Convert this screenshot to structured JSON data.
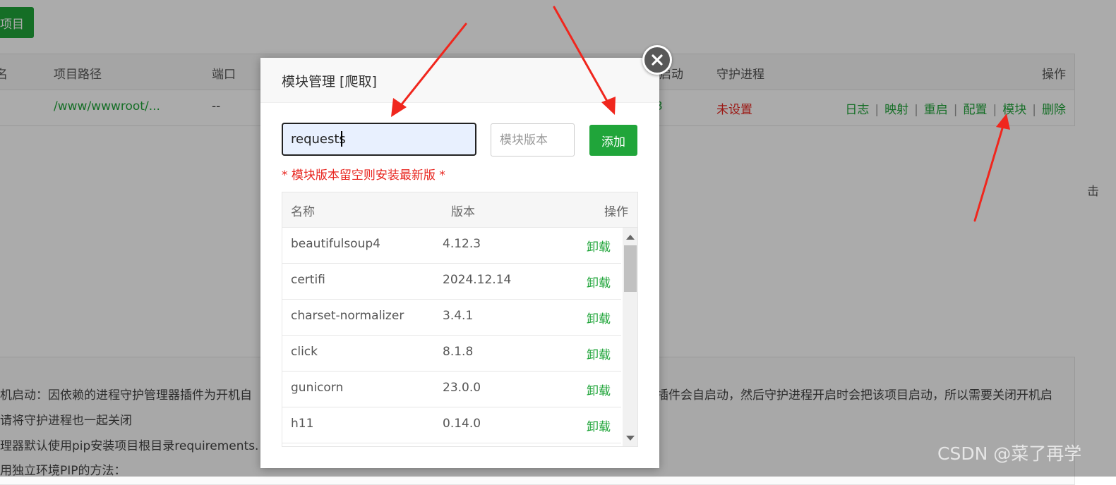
{
  "background": {
    "new_project_button": "项目",
    "table_headers": [
      "名",
      "项目路径",
      "端口",
      "启动",
      "守护进程",
      "操作"
    ],
    "row": {
      "path": "/www/wwwroot/...",
      "port": "--",
      "status_fragment": "3",
      "daemon": "未设置",
      "actions": [
        "日志",
        "映射",
        "重启",
        "配置",
        "模块",
        "删除"
      ]
    },
    "edge_fragment": "击",
    "notes": [
      "机启动：因依赖的进程守护管理器插件为开机自",
      "插件会自启动，然后守护进程开启时会把该项目启动，所以需要关闭开机启",
      "请将守护进程也一起关闭",
      "理器默认使用pip安装项目根目录requirements.",
      "用独立环境PIP的方法："
    ]
  },
  "modal": {
    "title": "模块管理 [爬取]",
    "name_input_value": "requests",
    "version_placeholder": "模块版本",
    "add_button": "添加",
    "hint": "* 模块版本留空则安装最新版 *",
    "table_headers": {
      "name": "名称",
      "version": "版本",
      "action": "操作"
    },
    "modules": [
      {
        "name": "beautifulsoup4",
        "version": "4.12.3",
        "action": "卸载"
      },
      {
        "name": "certifi",
        "version": "2024.12.14",
        "action": "卸载"
      },
      {
        "name": "charset-normalizer",
        "version": "3.4.1",
        "action": "卸载"
      },
      {
        "name": "click",
        "version": "8.1.8",
        "action": "卸载"
      },
      {
        "name": "gunicorn",
        "version": "23.0.0",
        "action": "卸载"
      },
      {
        "name": "h11",
        "version": "0.14.0",
        "action": "卸载"
      }
    ]
  },
  "watermark": "CSDN @菜了再学",
  "colors": {
    "accent_green": "#20a53a",
    "alert_red": "#e8251f",
    "annotation_arrow": "#f0261d"
  }
}
